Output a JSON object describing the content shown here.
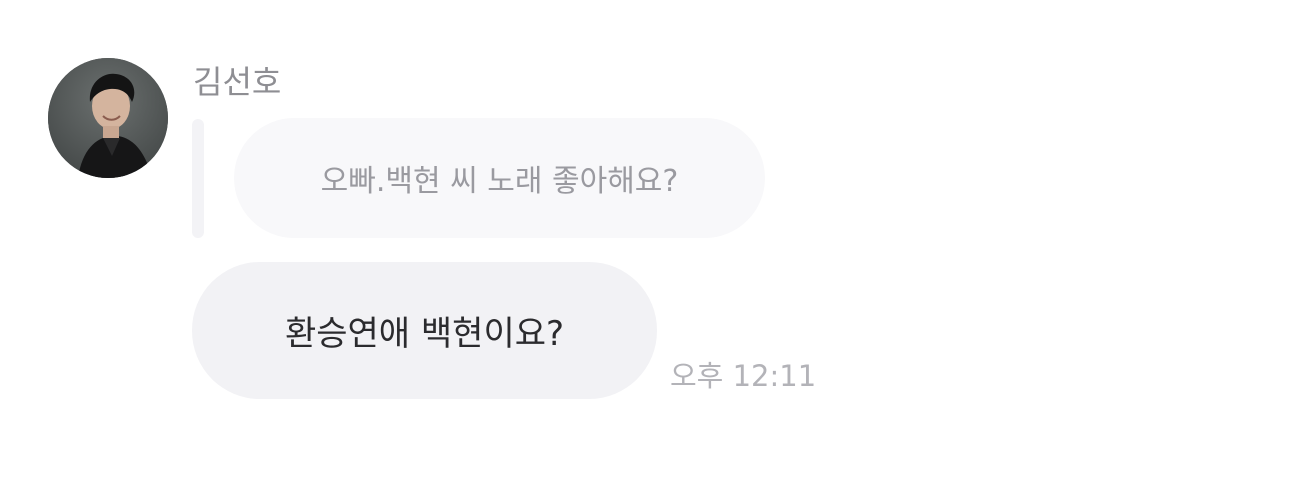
{
  "message": {
    "sender_name": "김선호",
    "avatar": "profile-photo-icon",
    "reply_quote": "오빠.백현 씨 노래 좋아해요?",
    "text": "환승연애 백현이요?",
    "time": "오후 12:11"
  }
}
